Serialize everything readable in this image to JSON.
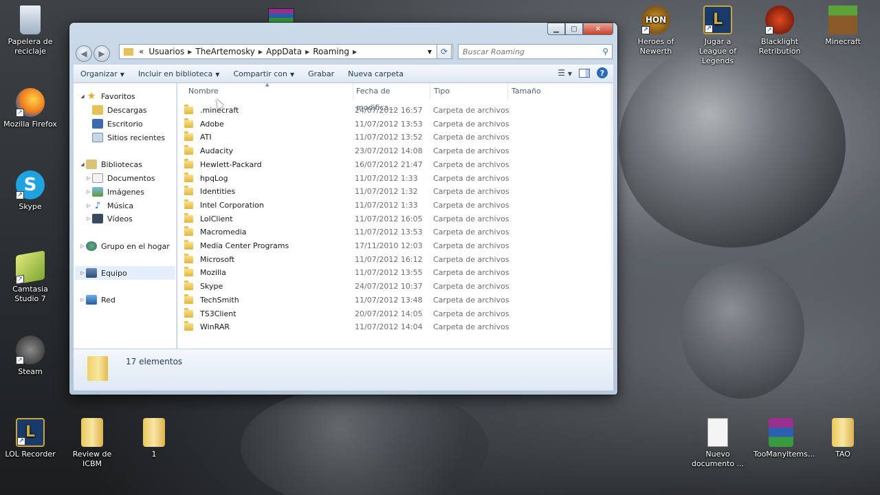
{
  "desktop": {
    "icons_left": [
      {
        "label": "Papelera de reciclaje"
      },
      {
        "label": "Mozilla Firefox"
      },
      {
        "label": "Skype"
      },
      {
        "label": "Camtasia Studio 7"
      },
      {
        "label": "Steam"
      }
    ],
    "icons_bottom": [
      {
        "label": "LOL Recorder"
      },
      {
        "label": "Review de ICBM"
      },
      {
        "label": "1"
      }
    ],
    "icons_right_top": [
      {
        "label": "Heroes of Newerth"
      },
      {
        "label": "Jugar a League of Legends"
      },
      {
        "label": "Blacklight Retribution"
      },
      {
        "label": "Minecraft"
      }
    ],
    "icons_right_bottom": [
      {
        "label": "Nuevo documento ..."
      },
      {
        "label": "TooManyItems..."
      },
      {
        "label": "TAO"
      }
    ]
  },
  "window": {
    "breadcrumb": [
      "Usuarios",
      "TheArtemosky",
      "AppData",
      "Roaming"
    ],
    "breadcrumb_overflow": "«",
    "search_placeholder": "Buscar Roaming",
    "toolbar": {
      "organize": "Organizar",
      "include_library": "Incluir en biblioteca",
      "share": "Compartir con",
      "burn": "Grabar",
      "new_folder": "Nueva carpeta"
    },
    "nav": {
      "favorites": "Favoritos",
      "downloads": "Descargas",
      "desktop": "Escritorio",
      "recent": "Sitios recientes",
      "libraries": "Bibliotecas",
      "documents": "Documentos",
      "pictures": "Imágenes",
      "music": "Música",
      "videos": "Vídeos",
      "homegroup": "Grupo en el hogar",
      "computer": "Equipo",
      "network": "Red"
    },
    "columns": {
      "name": "Nombre",
      "date": "Fecha de modifica...",
      "type": "Tipo",
      "size": "Tamaño"
    },
    "files": [
      {
        "name": ".minecraft",
        "date": "24/07/2012 16:57",
        "type": "Carpeta de archivos"
      },
      {
        "name": "Adobe",
        "date": "11/07/2012 13:53",
        "type": "Carpeta de archivos"
      },
      {
        "name": "ATI",
        "date": "11/07/2012 13:52",
        "type": "Carpeta de archivos"
      },
      {
        "name": "Audacity",
        "date": "23/07/2012 14:08",
        "type": "Carpeta de archivos"
      },
      {
        "name": "Hewlett-Packard",
        "date": "16/07/2012 21:47",
        "type": "Carpeta de archivos"
      },
      {
        "name": "hpqLog",
        "date": "11/07/2012 1:33",
        "type": "Carpeta de archivos"
      },
      {
        "name": "Identities",
        "date": "11/07/2012 1:32",
        "type": "Carpeta de archivos"
      },
      {
        "name": "Intel Corporation",
        "date": "11/07/2012 1:33",
        "type": "Carpeta de archivos"
      },
      {
        "name": "LolClient",
        "date": "11/07/2012 16:05",
        "type": "Carpeta de archivos"
      },
      {
        "name": "Macromedia",
        "date": "11/07/2012 13:53",
        "type": "Carpeta de archivos"
      },
      {
        "name": "Media Center Programs",
        "date": "17/11/2010 12:03",
        "type": "Carpeta de archivos"
      },
      {
        "name": "Microsoft",
        "date": "11/07/2012 16:12",
        "type": "Carpeta de archivos"
      },
      {
        "name": "Mozilla",
        "date": "11/07/2012 13:55",
        "type": "Carpeta de archivos"
      },
      {
        "name": "Skype",
        "date": "24/07/2012 10:37",
        "type": "Carpeta de archivos"
      },
      {
        "name": "TechSmith",
        "date": "11/07/2012 13:48",
        "type": "Carpeta de archivos"
      },
      {
        "name": "TS3Client",
        "date": "20/07/2012 14:05",
        "type": "Carpeta de archivos"
      },
      {
        "name": "WinRAR",
        "date": "11/07/2012 14:04",
        "type": "Carpeta de archivos"
      }
    ],
    "status_count": "17 elementos"
  }
}
